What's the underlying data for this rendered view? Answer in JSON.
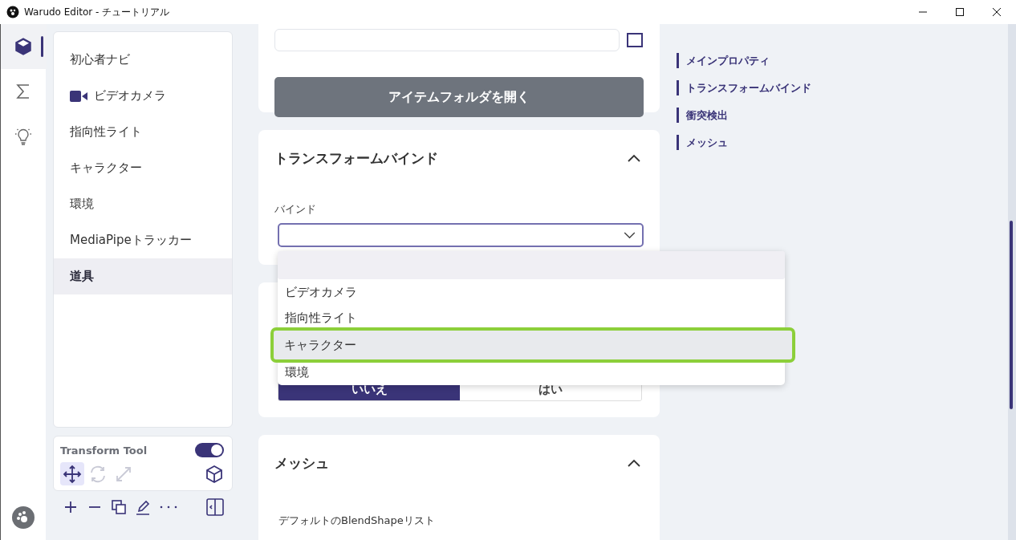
{
  "window": {
    "title": "Warudo Editor - チュートリアル"
  },
  "rail": [
    {
      "kind": "cube",
      "selected": true
    },
    {
      "kind": "sigma",
      "selected": false
    },
    {
      "kind": "bulb",
      "selected": false
    }
  ],
  "scene_list": [
    {
      "label": "初心者ナビ",
      "kind": "plain",
      "selected": false
    },
    {
      "label": "ビデオカメラ",
      "kind": "camera",
      "selected": false
    },
    {
      "label": "指向性ライト",
      "kind": "plain",
      "selected": false
    },
    {
      "label": "キャラクター",
      "kind": "plain",
      "selected": false
    },
    {
      "label": "環境",
      "kind": "plain",
      "selected": false
    },
    {
      "label": "MediaPipeトラッカー",
      "kind": "plain",
      "selected": false
    },
    {
      "label": "道具",
      "kind": "plain",
      "selected": true
    }
  ],
  "transform_tool": {
    "label": "Transform Tool",
    "on": true,
    "modes": [
      {
        "kind": "move",
        "selected": true,
        "disabled": false
      },
      {
        "kind": "rotate",
        "selected": false,
        "disabled": true
      },
      {
        "kind": "scale",
        "selected": false,
        "disabled": true
      }
    ]
  },
  "main": {
    "open_folder_button": "アイテムフォルダを開く",
    "bind_section": {
      "title": "トランスフォームバインド",
      "expanded": true,
      "field_label": "バインド"
    },
    "collision_section": {
      "options": [
        {
          "label": "いいえ",
          "selected": true
        },
        {
          "label": "はい",
          "selected": false
        }
      ]
    },
    "mesh_section": {
      "title": "メッシュ",
      "expanded": true,
      "field_label": "デフォルトのBlendShapeリスト"
    }
  },
  "dropdown": {
    "options": [
      {
        "highlighted": true,
        "focused": false
      },
      {
        "label": "ビデオカメラ",
        "highlighted": false,
        "focused": false
      },
      {
        "label": "指向性ライト",
        "highlighted": false,
        "focused": false
      },
      {
        "label": "キャラクター",
        "highlighted": false,
        "focused": true
      },
      {
        "label": "環境",
        "highlighted": false,
        "focused": false
      }
    ]
  },
  "toc": [
    "メインプロパティ",
    "トランスフォームバインド",
    "衝突検出",
    "メッシュ"
  ]
}
